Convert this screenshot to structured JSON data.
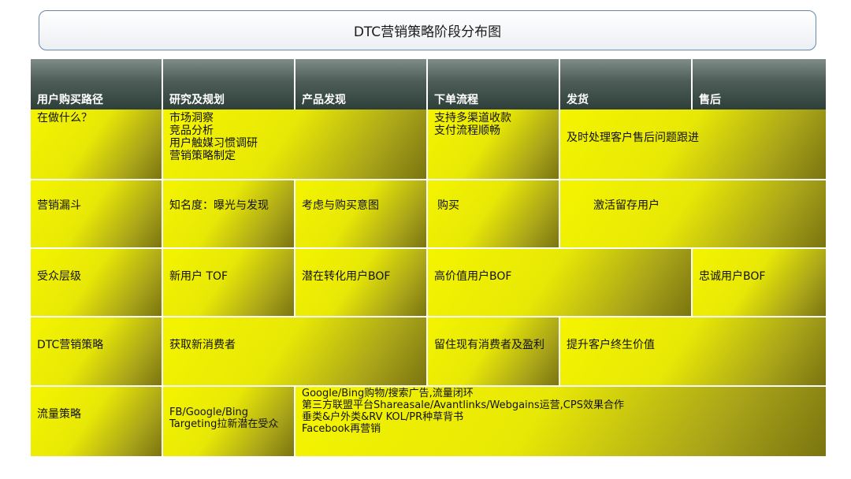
{
  "title": "DTC营销策略阶段分布图",
  "headers": [
    "用户购买路径",
    "研究及规划",
    "产品发现",
    "下单流程",
    "发货",
    "售后"
  ],
  "rows": {
    "r1": {
      "label": "在做什么？",
      "research": [
        "市场洞察",
        "竞品分析",
        "用户触媒习惯调研",
        "营销策略制定"
      ],
      "order": [
        "支持多渠道收款",
        "支付流程顺畅"
      ],
      "ship": "及时处理客户售后问题跟进"
    },
    "r2": {
      "label": "营销漏斗",
      "research": "知名度：曝光与发现",
      "discovery": "考虑与购买意图",
      "order": "购买",
      "ship": "激活留存用户"
    },
    "r3": {
      "label": "受众层级",
      "research": "新用户 TOF",
      "discovery": "潜在转化用户BOF",
      "order": "高价值用户BOF",
      "after": "忠诚用户BOF"
    },
    "r4": {
      "label": "DTC营销策略",
      "research": "获取新消费者",
      "order": "留住现有消费者及盈利",
      "ship": "提升客户终生价值"
    },
    "r5": {
      "label": "流量策略",
      "research": "FB/Google/Bing Targeting拉新潜在受众",
      "discovery": [
        "Google/Bing购物/搜索广告,流量闭环",
        "第三方联盟平台Shareasale/Avantlinks/Webgains运营,CPS效果合作",
        "垂类&户外类&RV KOL/PR种草背书",
        "Facebook再营销"
      ]
    }
  }
}
